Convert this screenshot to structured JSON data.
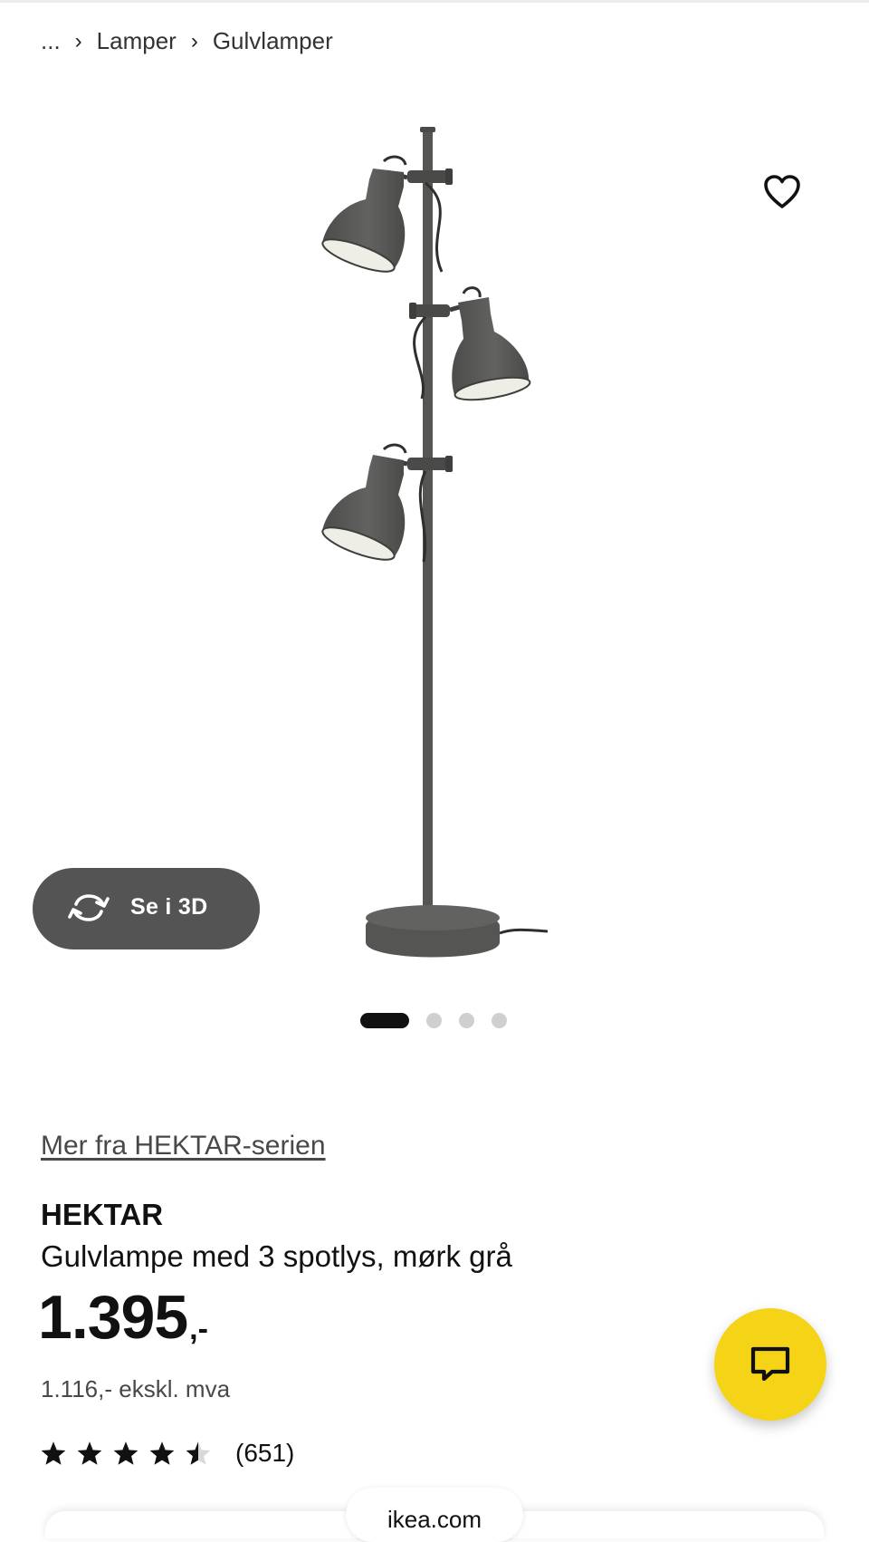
{
  "breadcrumb": {
    "ellipsis": "...",
    "separator": "›",
    "items": [
      "Lamper",
      "Gulvlamper"
    ]
  },
  "gallery": {
    "view_3d_label": "Se i 3D",
    "image_count": 4,
    "active_index": 0
  },
  "product": {
    "series_link": "Mer fra HEKTAR-serien",
    "name": "HEKTAR",
    "description": "Gulvlampe med 3 spotlys, mørk grå",
    "price_integer": "1.395",
    "price_suffix": ",-",
    "price_excl_vat": "1.116,- ekskl. mva",
    "rating": 4.5,
    "rating_max": 5,
    "review_count": "(651)"
  },
  "browser": {
    "url": "ikea.com"
  },
  "icons": {
    "favorite": "heart-icon",
    "rotate_3d": "rotate-3d-icon",
    "chat": "chat-bubble-icon",
    "star": "star-icon"
  },
  "colors": {
    "chat_fab": "#f5d417",
    "button_3d": "#545454",
    "lamp": "#5b5b59"
  }
}
